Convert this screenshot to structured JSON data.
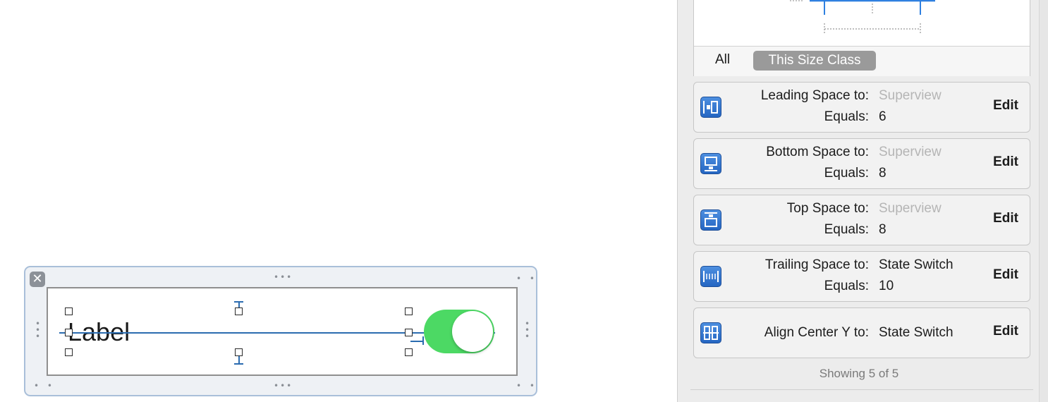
{
  "canvas": {
    "cell": {
      "close_glyph": "✕",
      "label_text": "Label",
      "switch_state": "on",
      "switch_color": "#4cd964",
      "dots_glyph": "•••"
    }
  },
  "inspector": {
    "size_class_tabs": {
      "all_label": "All",
      "this_size_class_label": "This Size Class"
    },
    "constraints": [
      {
        "icon": "leading-space-icon",
        "relation_label": "Leading Space to:",
        "target": "Superview",
        "target_muted": true,
        "equals_label": "Equals:",
        "equals_value": "6",
        "edit_label": "Edit"
      },
      {
        "icon": "bottom-space-icon",
        "relation_label": "Bottom Space to:",
        "target": "Superview",
        "target_muted": true,
        "equals_label": "Equals:",
        "equals_value": "8",
        "edit_label": "Edit"
      },
      {
        "icon": "top-space-icon",
        "relation_label": "Top Space to:",
        "target": "Superview",
        "target_muted": true,
        "equals_label": "Equals:",
        "equals_value": "8",
        "edit_label": "Edit"
      },
      {
        "icon": "trailing-space-icon",
        "relation_label": "Trailing Space to:",
        "target": "State Switch",
        "target_muted": false,
        "equals_label": "Equals:",
        "equals_value": "10",
        "edit_label": "Edit"
      },
      {
        "icon": "align-center-y-icon",
        "relation_label": "Align Center Y to:",
        "target": "State Switch",
        "target_muted": false,
        "edit_label": "Edit"
      }
    ],
    "showing_text": "Showing 5 of 5",
    "accent_color": "#2b6cb0"
  }
}
